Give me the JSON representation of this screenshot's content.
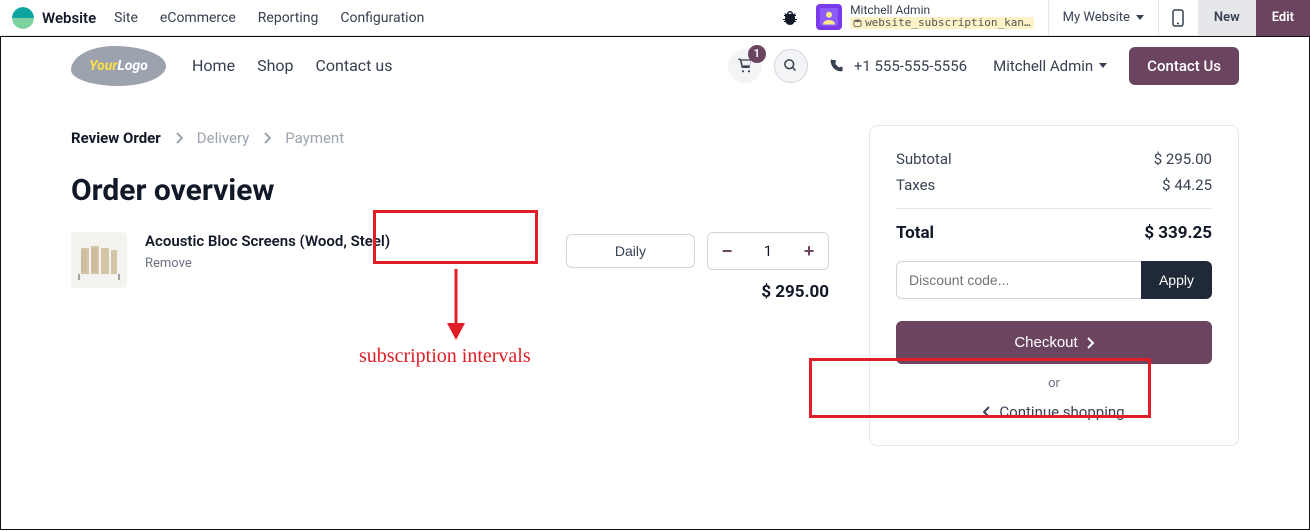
{
  "topbar": {
    "app_name": "Website",
    "menu": [
      "Site",
      "eCommerce",
      "Reporting",
      "Configuration"
    ],
    "user_name": "Mitchell Admin",
    "user_context": "website_subscription_kan…",
    "my_website": "My Website",
    "new_btn": "New",
    "edit_btn": "Edit"
  },
  "sitebar": {
    "logo_text_1": "Your",
    "logo_text_2": "Logo",
    "nav": [
      "Home",
      "Shop",
      "Contact us"
    ],
    "cart_count": "1",
    "phone": "+1 555-555-5556",
    "user": "Mitchell Admin",
    "contact_btn": "Contact Us"
  },
  "breadcrumb": {
    "step1": "Review Order",
    "step2": "Delivery",
    "step3": "Payment"
  },
  "page_title": "Order overview",
  "cart_item": {
    "title": "Acoustic Bloc Screens (Wood, Steel)",
    "remove": "Remove",
    "interval": "Daily",
    "qty": "1",
    "price": "$ 295.00"
  },
  "annotation_label": "subscription intervals",
  "summary": {
    "subtotal_label": "Subtotal",
    "subtotal_value": "$ 295.00",
    "taxes_label": "Taxes",
    "taxes_value": "$ 44.25",
    "total_label": "Total",
    "total_value": "$ 339.25",
    "discount_placeholder": "Discount code...",
    "apply_btn": "Apply",
    "checkout_btn": "Checkout",
    "or_text": "or",
    "continue_link": "Continue shopping"
  }
}
